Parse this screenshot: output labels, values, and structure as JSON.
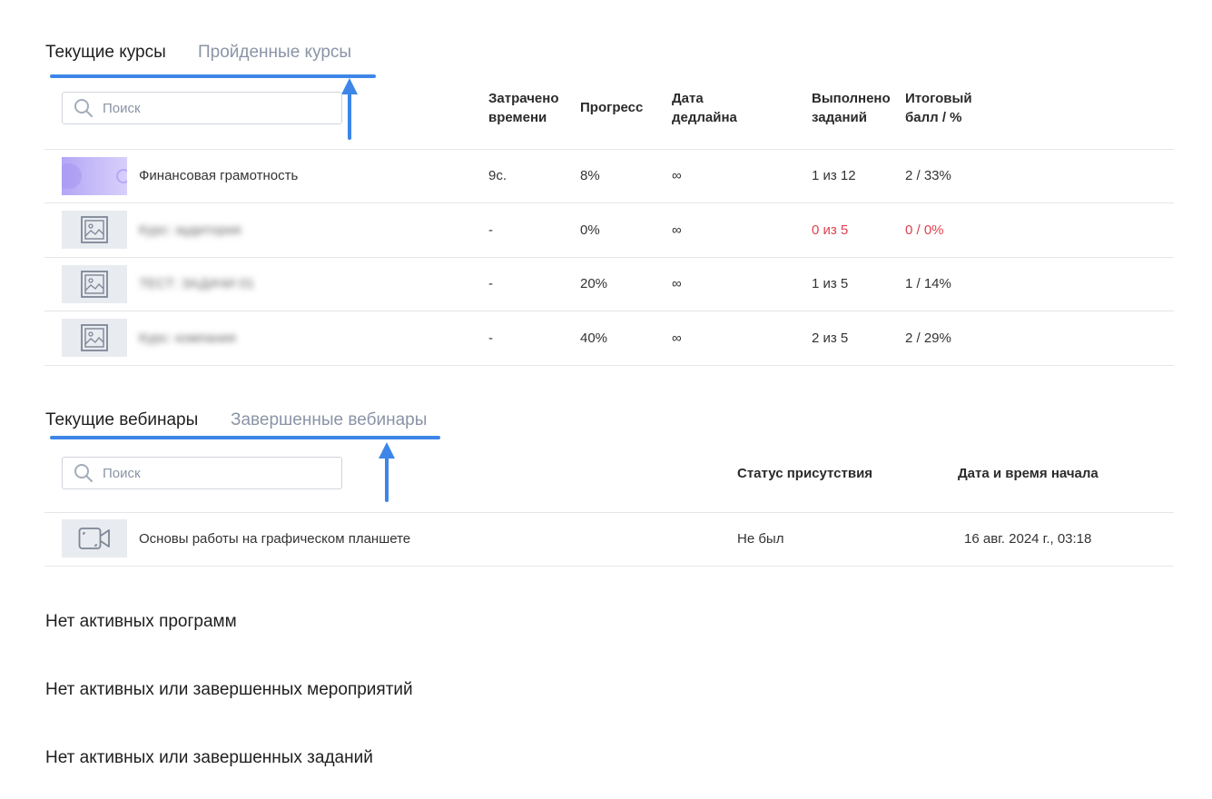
{
  "courses": {
    "tabs": {
      "current": "Текущие курсы",
      "completed": "Пройденные курсы"
    },
    "search_placeholder": "Поиск",
    "headers": {
      "time": [
        "Затрачено",
        "времени"
      ],
      "progress": "Прогресс",
      "deadline": [
        "Дата",
        "дедлайна"
      ],
      "done": [
        "Выполнено",
        "заданий"
      ],
      "score": [
        "Итоговый",
        "балл / %"
      ]
    },
    "rows": [
      {
        "title": "Финансовая грамотность",
        "time": "9с.",
        "progress": "8%",
        "deadline": "∞",
        "done": "1 из 12",
        "score": "2 / 33%"
      },
      {
        "title": "Курс: аудитория",
        "time": "-",
        "progress": "0%",
        "deadline": "∞",
        "done": "0 из 5",
        "score": "0 / 0%"
      },
      {
        "title": "ТЕСТ: ЗАДАЧИ 01",
        "time": "-",
        "progress": "20%",
        "deadline": "∞",
        "done": "1 из 5",
        "score": "1 / 14%"
      },
      {
        "title": "Курс: компания",
        "time": "-",
        "progress": "40%",
        "deadline": "∞",
        "done": "2 из 5",
        "score": "2 / 29%"
      }
    ]
  },
  "webinars": {
    "tabs": {
      "current": "Текущие вебинары",
      "completed": "Завершенные вебинары"
    },
    "search_placeholder": "Поиск",
    "headers": {
      "attendance": "Статус присутствия",
      "start": "Дата и время начала"
    },
    "rows": [
      {
        "title": "Основы работы на графическом планшете",
        "attendance": "Не был",
        "start": "16 авг. 2024 г., 03:18"
      }
    ]
  },
  "empty_states": {
    "programs": "Нет активных программ",
    "events": "Нет активных или завершенных мероприятий",
    "tasks": "Нет активных или завершенных заданий"
  },
  "colors": {
    "accent": "#3d86e8",
    "error": "#e0404f",
    "muted": "#8a94a6"
  }
}
